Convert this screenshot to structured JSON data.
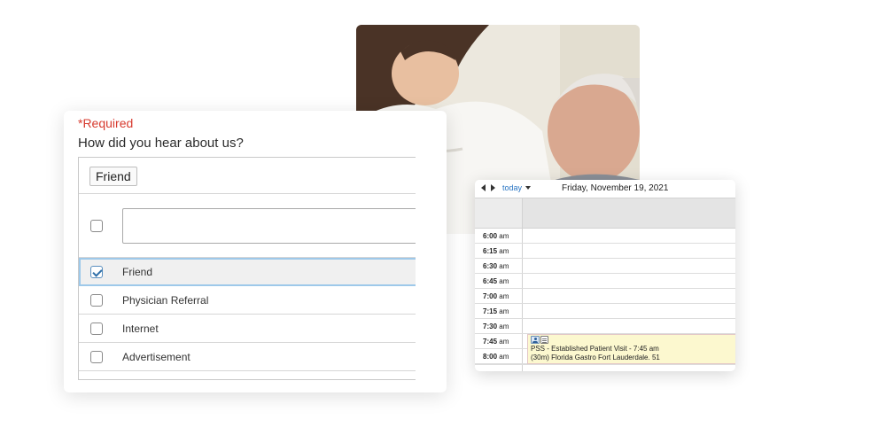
{
  "form": {
    "required_label": "*Required",
    "question": "How did you hear about us?",
    "selected_tag": "Friend",
    "search_value": "",
    "options": [
      {
        "label": "Friend",
        "checked": true
      },
      {
        "label": "Physician Referral",
        "checked": false
      },
      {
        "label": "Internet",
        "checked": false
      },
      {
        "label": "Advertisement",
        "checked": false
      }
    ]
  },
  "calendar": {
    "today_label": "today",
    "date_title": "Friday, November 19, 2021",
    "times": [
      {
        "time": "6:00",
        "ampm": "am"
      },
      {
        "time": "6:15",
        "ampm": "am"
      },
      {
        "time": "6:30",
        "ampm": "am"
      },
      {
        "time": "6:45",
        "ampm": "am"
      },
      {
        "time": "7:00",
        "ampm": "am"
      },
      {
        "time": "7:15",
        "ampm": "am"
      },
      {
        "time": "7:30",
        "ampm": "am"
      },
      {
        "time": "7:45",
        "ampm": "am"
      },
      {
        "time": "8:00",
        "ampm": "am"
      }
    ],
    "event": {
      "line1": "PSS - Established Patient Visit - 7:45 am",
      "line2": "(30m) Florida Gastro Fort Lauderdale. 51",
      "color": "#fcf8cf"
    }
  },
  "colors": {
    "required": "#d73a2e",
    "link": "#2a76c4",
    "selected_border": "#9ec9ea"
  }
}
